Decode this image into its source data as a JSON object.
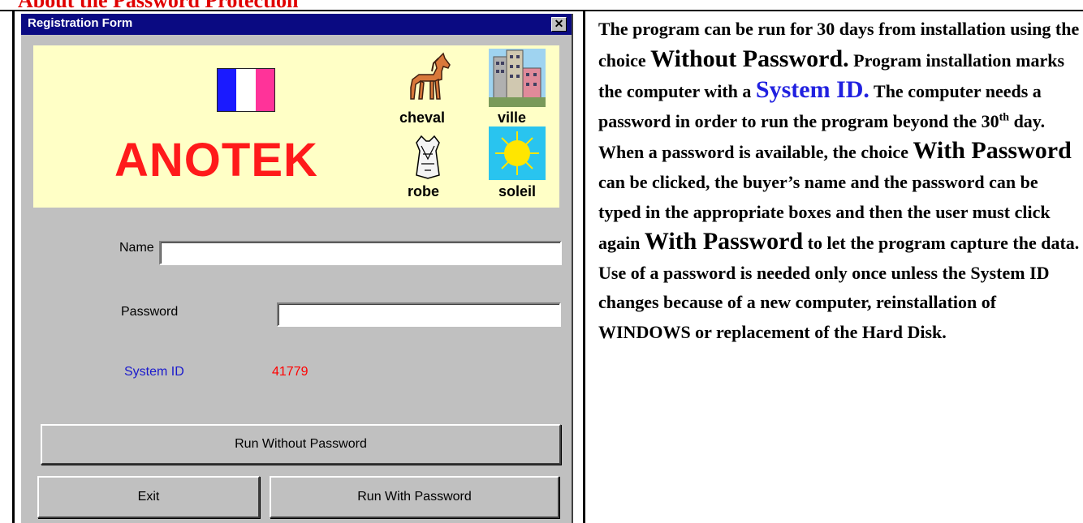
{
  "heading": "About the Password Protection",
  "window": {
    "title": "Registration Form",
    "close_label": "✕",
    "brand": "ANOTEK",
    "flag_colors": [
      "#1a1aff",
      "#ffffff",
      "#ff3399"
    ],
    "pictures": [
      {
        "word": "cheval",
        "icon": "horse-icon"
      },
      {
        "word": "ville",
        "icon": "city-icon"
      },
      {
        "word": "robe",
        "icon": "dress-icon"
      },
      {
        "word": "soleil",
        "icon": "sun-icon"
      }
    ],
    "name_label": "Name",
    "name_value": "",
    "password_label": "Password",
    "password_value": "",
    "system_id_label": "System ID",
    "system_id_value": "41779",
    "run_without_label": "Run Without Password",
    "exit_label": "Exit",
    "run_with_label": "Run With Password"
  },
  "description": {
    "t1": "The program can be run for 30 days from installation using the choice ",
    "b1": "Without Password.",
    "t2": "  Program installation marks the computer with a ",
    "b2": "System ID.",
    "t3": "  The computer needs a password in order to run the program beyond the 30",
    "sup": "th",
    "t4": " day.  When a password is available, the choice ",
    "b3": "With Password",
    "t5": " can be clicked, the buyer’s name and the password can be typed in the appropriate boxes and then the user must click again ",
    "b4": "With Password",
    "t6": " to let the program capture the data.  Use of a password is needed only once unless the System ID changes because of a new computer, reinstallation of WINDOWS or replacement of the Hard Disk."
  }
}
